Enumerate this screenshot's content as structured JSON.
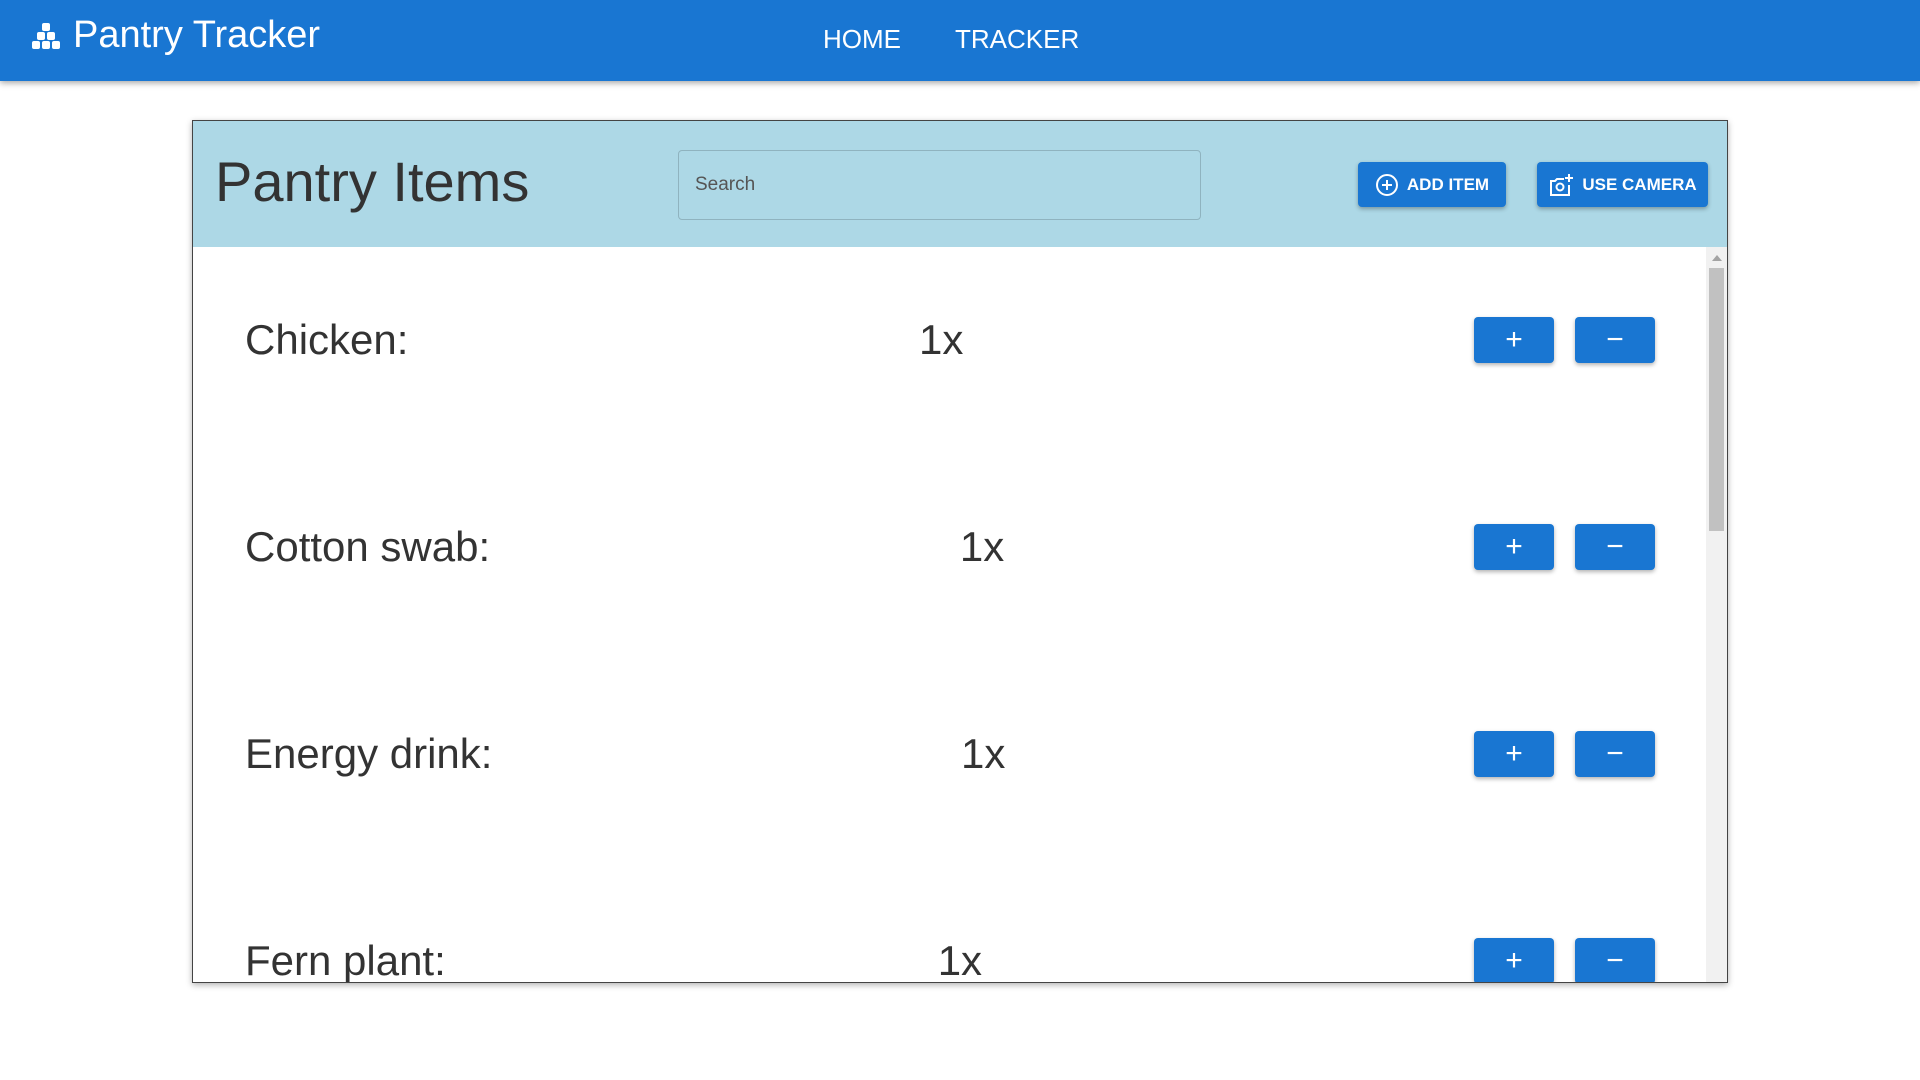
{
  "nav": {
    "title": "Pantry Tracker",
    "links": [
      "HOME",
      "TRACKER"
    ]
  },
  "card": {
    "title": "Pantry Items",
    "search_placeholder": "Search",
    "add_label": "ADD ITEM",
    "camera_label": "USE CAMERA"
  },
  "items": [
    {
      "name": "Chicken:",
      "qty": "1x"
    },
    {
      "name": "Cotton swab:",
      "qty": "1x"
    },
    {
      "name": "Energy drink:",
      "qty": "1x"
    },
    {
      "name": "Fern plant:",
      "qty": "1x"
    }
  ],
  "controls": {
    "plus": "+",
    "minus": "−"
  },
  "colors": {
    "primary": "#1976d2",
    "header": "#add8e6"
  }
}
